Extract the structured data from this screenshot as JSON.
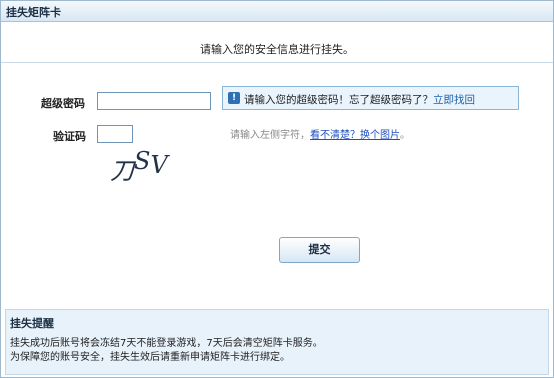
{
  "window": {
    "title": "挂失矩阵卡"
  },
  "form": {
    "intro": "请输入您的安全信息进行挂失。",
    "super_password": {
      "label": "超级密码",
      "hint_icon": "info-icon",
      "hint_text": "请输入您的超级密码！忘了超级密码了？",
      "hint_link": "立即找回"
    },
    "captcha": {
      "label": "验证码",
      "hint_text": "请输入左侧字符，",
      "hint_link": "看不清楚？换个图片",
      "hint_tail": "。",
      "image_text": "刀SV"
    },
    "submit_label": "提交"
  },
  "notice": {
    "title": "挂失提醒",
    "line1": "挂失成功后账号将会冻结7天不能登录游戏，7天后会清空矩阵卡服务。",
    "line2": "为保障您的账号安全，挂失生效后请重新申请矩阵卡进行绑定。"
  },
  "colors": {
    "accent": "#1d5fa8",
    "border": "#8bb5d6",
    "panel": "#e8f2fb"
  }
}
